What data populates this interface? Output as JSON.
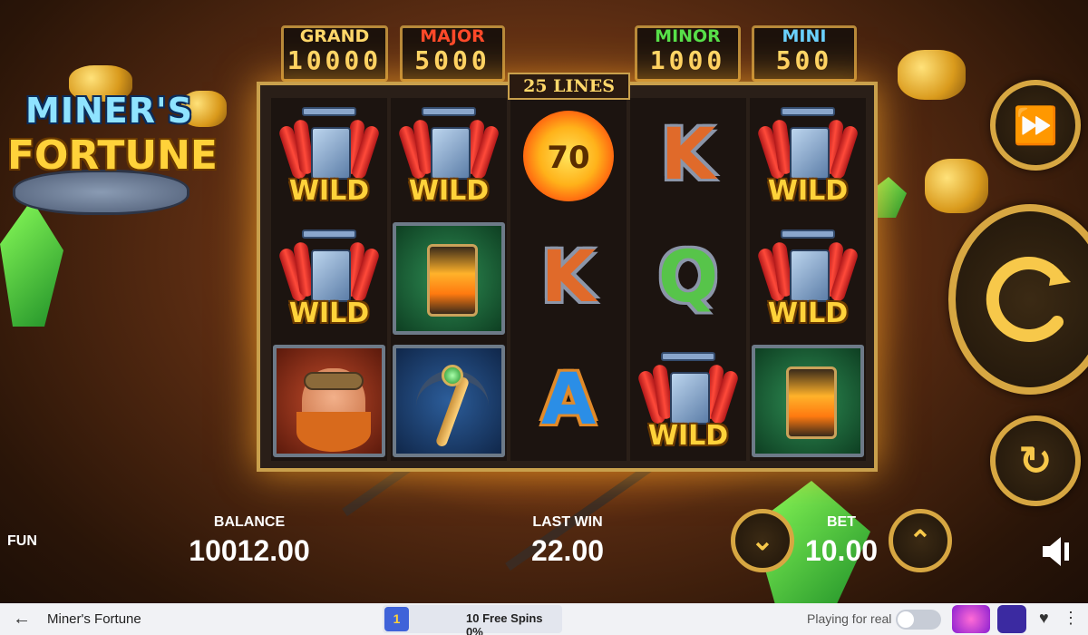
{
  "game": {
    "logo_line1": "MINER'S",
    "logo_line2": "FORTUNE",
    "lines_label": "25 LINES"
  },
  "jackpots": [
    {
      "label": "GRAND",
      "value": "10000",
      "color": "#ffd86a"
    },
    {
      "label": "MAJOR",
      "value": "5000",
      "color": "#ff4a2a"
    },
    {
      "label": "MINOR",
      "value": "1000",
      "color": "#57e04a"
    },
    {
      "label": "MINI",
      "value": "500",
      "color": "#6ad2ff"
    }
  ],
  "reels": [
    [
      "WILD",
      "WILD",
      "miner"
    ],
    [
      "WILD",
      "lantern",
      "pickaxe"
    ],
    [
      "70",
      "K",
      "A"
    ],
    [
      "K",
      "Q",
      "WILD"
    ],
    [
      "WILD",
      "WILD",
      "lantern"
    ]
  ],
  "symbols": {
    "wild": "WILD",
    "coin_value": "70",
    "k": "K",
    "q": "Q",
    "a": "A"
  },
  "stats": {
    "mode": "FUN",
    "balance_label": "BALANCE",
    "balance_value": "10012.00",
    "last_win_label": "LAST WIN",
    "last_win_value": "22.00",
    "bet_label": "BET",
    "bet_value": "10.00"
  },
  "footer": {
    "title": "Miner's Fortune",
    "promo_badge": "1",
    "promo_text": "10 Free Spins 0%",
    "playing_for_real": "Playing for real"
  },
  "icons": {
    "back": "arrow-left-icon",
    "fast_forward": "fast-forward-icon",
    "spin": "spin-icon",
    "autoplay": "autoplay-icon",
    "bet_down": "chevron-down-icon",
    "bet_up": "chevron-up-icon",
    "sound": "speaker-icon",
    "favorite": "heart-icon",
    "menu": "menu-icon"
  },
  "colors": {
    "accent_gold": "#d7a742",
    "wild_yellow": "#ffd23a"
  }
}
